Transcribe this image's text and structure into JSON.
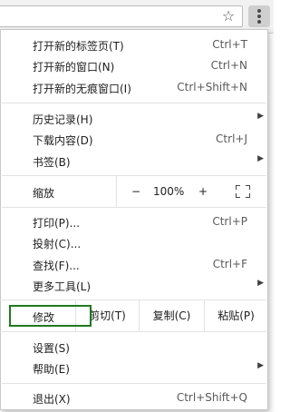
{
  "toolbar": {
    "star_glyph": "☆"
  },
  "menu": {
    "new_tab": {
      "label": "打开新的标签页(T)",
      "shortcut": "Ctrl+T"
    },
    "new_window": {
      "label": "打开新的窗口(N)",
      "shortcut": "Ctrl+N"
    },
    "new_incognito": {
      "label": "打开新的无痕窗口(I)",
      "shortcut": "Ctrl+Shift+N"
    },
    "history": {
      "label": "历史记录(H)"
    },
    "downloads": {
      "label": "下载内容(D)",
      "shortcut": "Ctrl+J"
    },
    "bookmarks": {
      "label": "书签(B)"
    },
    "zoom": {
      "label": "缩放",
      "minus": "−",
      "value": "100%",
      "plus": "+"
    },
    "print": {
      "label": "打印(P)...",
      "shortcut": "Ctrl+P"
    },
    "cast": {
      "label": "投射(C)..."
    },
    "find": {
      "label": "查找(F)...",
      "shortcut": "Ctrl+F"
    },
    "more_tools": {
      "label": "更多工具(L)"
    },
    "edit": {
      "label": "修改",
      "cut": "剪切(T)",
      "copy": "复制(C)",
      "paste": "粘贴(P)"
    },
    "settings": {
      "label": "设置(S)"
    },
    "help": {
      "label": "帮助(E)"
    },
    "exit": {
      "label": "退出(X)",
      "shortcut": "Ctrl+Shift+Q"
    },
    "submenu_arrow": "▶"
  },
  "colors": {
    "highlight": "#1e7a1e"
  }
}
